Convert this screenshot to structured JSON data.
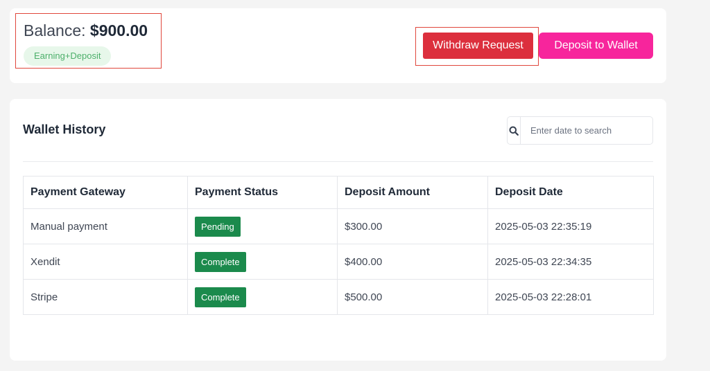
{
  "balance": {
    "label": "Balance:",
    "amount": "$900.00",
    "badge": "Earning+Deposit"
  },
  "actions": {
    "withdraw_label": "Withdraw Request",
    "deposit_label": "Deposit to Wallet"
  },
  "history": {
    "title": "Wallet History",
    "search": {
      "placeholder": "Enter date to search",
      "value": "",
      "icon": "search-icon"
    },
    "columns": [
      "Payment Gateway",
      "Payment Status",
      "Deposit Amount",
      "Deposit Date"
    ],
    "rows": [
      {
        "gateway": "Manual payment",
        "status": "Pending",
        "amount": "$300.00",
        "date": "2025-05-03 22:35:19"
      },
      {
        "gateway": "Xendit",
        "status": "Complete",
        "amount": "$400.00",
        "date": "2025-05-03 22:34:35"
      },
      {
        "gateway": "Stripe",
        "status": "Complete",
        "amount": "$500.00",
        "date": "2025-05-03 22:28:01"
      }
    ]
  },
  "colors": {
    "withdraw": "#dc2f3d",
    "deposit": "#f7259c",
    "status_badge": "#1b8a4c",
    "earning_badge_bg": "#e7f7ea",
    "highlight_outline": "#e0463b"
  }
}
